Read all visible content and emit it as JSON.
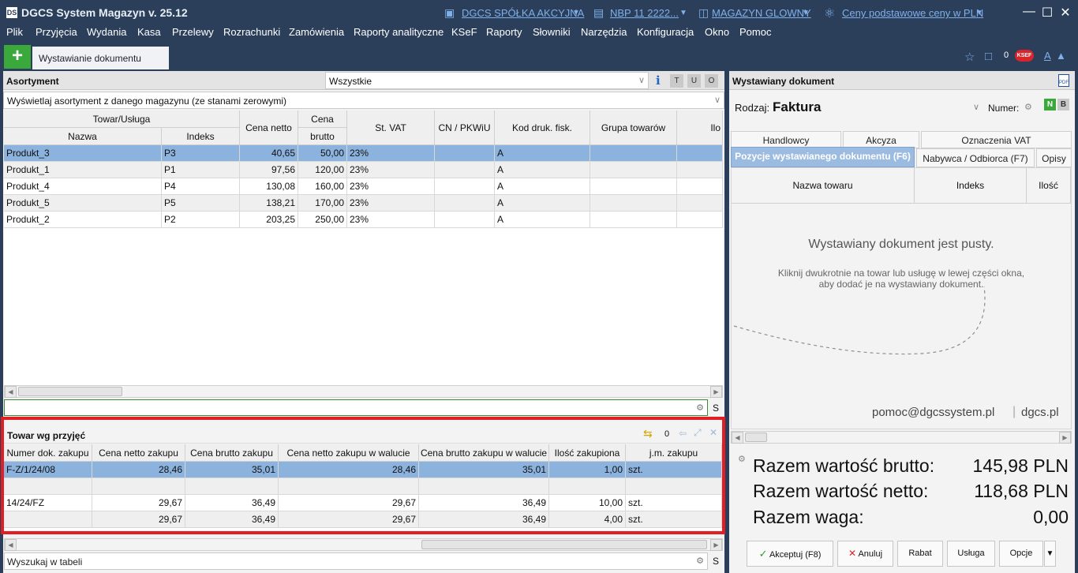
{
  "app": {
    "logo": "DS",
    "title": "DGCS System Magazyn v. 25.12",
    "company": "DGCS SPÓŁKA AKCYJNA",
    "bank": "NBP 11 2222...",
    "warehouse": "MAGAZYN GLOWNY",
    "prices": "Ceny podstawowe ceny w PLN"
  },
  "menu": [
    "Plik",
    "Przyjęcia",
    "Wydania",
    "Kasa",
    "Przelewy",
    "Rozrachunki",
    "Zamówienia",
    "Raporty analityczne",
    "KSeF",
    "Raporty",
    "Słowniki",
    "Narzędzia",
    "Konfiguracja",
    "Okno",
    "Pomoc"
  ],
  "tab": {
    "label": "Wystawianie dokumentu",
    "plus": "+",
    "badge_count": "0",
    "ksef": "KSEF",
    "font_a": "A"
  },
  "assortment": {
    "title": "Asortyment",
    "filter": "Wszystkie",
    "info": "i",
    "toggles": [
      "T",
      "U",
      "O"
    ],
    "scope": "Wyświetlaj asortyment z danego magazynu (ze stanami zerowymi)",
    "headers": {
      "group": "Towar/Usługa",
      "name": "Nazwa",
      "index": "Indeks",
      "net": "Cena netto",
      "gross_top": "Cena",
      "gross_bottom": "brutto",
      "vat": "St. VAT",
      "cn": "CN / PKWiU",
      "fisk": "Kod druk. fisk.",
      "group2": "Grupa towarów",
      "qty": "Ilo"
    },
    "rows": [
      {
        "name": "Produkt_3",
        "index": "P3",
        "net": "40,65",
        "gross": "50,00",
        "vat": "23%",
        "fisk": "A"
      },
      {
        "name": "Produkt_1",
        "index": "P1",
        "net": "97,56",
        "gross": "120,00",
        "vat": "23%",
        "fisk": "A"
      },
      {
        "name": "Produkt_4",
        "index": "P4",
        "net": "130,08",
        "gross": "160,00",
        "vat": "23%",
        "fisk": "A"
      },
      {
        "name": "Produkt_5",
        "index": "P5",
        "net": "138,21",
        "gross": "170,00",
        "vat": "23%",
        "fisk": "A"
      },
      {
        "name": "Produkt_2",
        "index": "P2",
        "net": "203,25",
        "gross": "250,00",
        "vat": "23%",
        "fisk": "A"
      }
    ],
    "search_s": "S"
  },
  "receipts": {
    "title": "Towar wg przyjęć",
    "count": "0",
    "headers": [
      "Numer dok. zakupu",
      "Cena netto zakupu",
      "Cena brutto zakupu",
      "Cena netto zakupu w walucie",
      "Cena brutto zakupu w walucie",
      "Ilość zakupiona",
      "j.m. zakupu"
    ],
    "rows": [
      [
        "F-Z/1/24/08",
        "28,46",
        "35,01",
        "28,46",
        "35,01",
        "1,00",
        "szt."
      ],
      [
        "",
        "",
        "",
        "",
        "",
        "",
        ""
      ],
      [
        "14/24/FZ",
        "29,67",
        "36,49",
        "29,67",
        "36,49",
        "10,00",
        "szt."
      ],
      [
        "",
        "29,67",
        "36,49",
        "29,67",
        "36,49",
        "4,00",
        "szt."
      ]
    ],
    "search": "Wyszukaj w tabeli",
    "search_s": "S"
  },
  "document": {
    "title": "Wystawiany dokument",
    "type_label": "Rodzaj:",
    "type": "Faktura",
    "number_label": "Numer:",
    "nb": [
      "N",
      "B"
    ],
    "tabs_top": [
      "Handlowcy",
      "Akcyza",
      "Oznaczenia VAT"
    ],
    "tabs_bottom": [
      "Pozycje wystawianego dokumentu (F6)",
      "Nabywca / Odbiorca (F7)",
      "Opisy"
    ],
    "cols": [
      "Nazwa towaru",
      "Indeks",
      "Ilość"
    ],
    "empty_title": "Wystawiany dokument jest pusty.",
    "empty_line1": "Kliknij dwukrotnie na towar lub usługę w lewej części okna,",
    "empty_line2": "aby dodać je na wystawiany dokument.",
    "help_email": "pomoc@dgcssystem.pl",
    "help_site": "dgcs.pl",
    "totals": [
      {
        "label": "Razem wartość brutto:",
        "value": "145,98 PLN"
      },
      {
        "label": "Razem wartość netto:",
        "value": "118,68 PLN"
      },
      {
        "label": "Razem waga:",
        "value": "0,00"
      }
    ],
    "buttons": [
      "Akceptuj (F8)",
      "Anuluj",
      "Rabat",
      "Usługa",
      "Opcje"
    ]
  }
}
